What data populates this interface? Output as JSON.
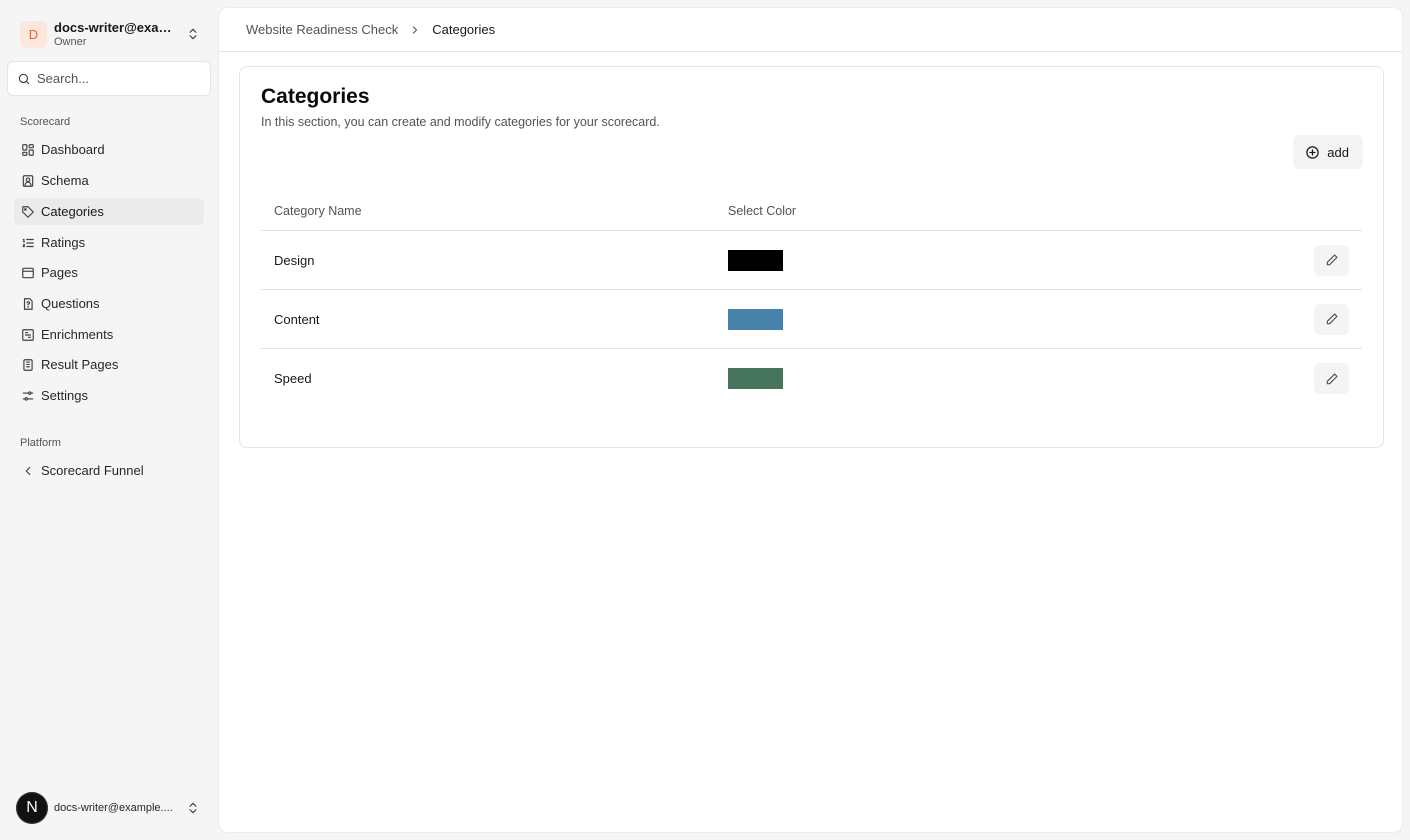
{
  "team": {
    "avatar_letter": "D",
    "name": "docs-writer@exam...",
    "role": "Owner"
  },
  "search": {
    "placeholder": "Search..."
  },
  "sidebar": {
    "groups": [
      {
        "label": "Scorecard",
        "items": [
          {
            "label": "Dashboard",
            "icon": "dashboard-icon",
            "active": false
          },
          {
            "label": "Schema",
            "icon": "schema-icon",
            "active": false
          },
          {
            "label": "Categories",
            "icon": "tag-icon",
            "active": true
          },
          {
            "label": "Ratings",
            "icon": "list-ordered-icon",
            "active": false
          },
          {
            "label": "Pages",
            "icon": "pages-icon",
            "active": false
          },
          {
            "label": "Questions",
            "icon": "question-icon",
            "active": false
          },
          {
            "label": "Enrichments",
            "icon": "enrichments-icon",
            "active": false
          },
          {
            "label": "Result Pages",
            "icon": "result-pages-icon",
            "active": false
          },
          {
            "label": "Settings",
            "icon": "settings-icon",
            "active": false
          }
        ]
      },
      {
        "label": "Platform",
        "items": [
          {
            "label": "Scorecard Funnel",
            "icon": "chevron-left-icon",
            "active": false
          }
        ]
      }
    ]
  },
  "user": {
    "avatar_letter": "N",
    "email": "docs-writer@example...."
  },
  "breadcrumb": {
    "parent": "Website Readiness Check",
    "current": "Categories"
  },
  "page": {
    "title": "Categories",
    "description": "In this section, you can create and modify categories for your scorecard.",
    "add_label": "add"
  },
  "table": {
    "columns": [
      "Category Name",
      "Select Color"
    ],
    "rows": [
      {
        "name": "Design",
        "color": "#000000"
      },
      {
        "name": "Content",
        "color": "#4682a9"
      },
      {
        "name": "Speed",
        "color": "#47745c"
      }
    ]
  }
}
